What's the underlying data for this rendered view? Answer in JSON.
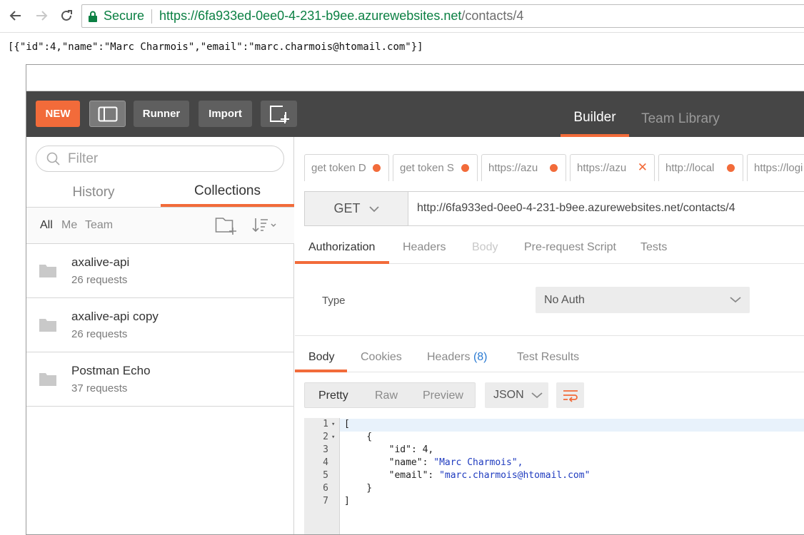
{
  "browser": {
    "secure_label": "Secure",
    "url_scheme": "https://",
    "url_host": "6fa933ed-0ee0-4-231-b9ee.azurewebsites.net",
    "url_path": "/contacts/4"
  },
  "raw_response": "[{\"id\":4,\"name\":\"Marc Charmois\",\"email\":\"marc.charmois@htomail.com\"}]",
  "header": {
    "new_label": "NEW",
    "runner_label": "Runner",
    "import_label": "Import",
    "builder_tab": "Builder",
    "team_library_tab": "Team Library"
  },
  "sidebar": {
    "filter_placeholder": "Filter",
    "tab_history": "History",
    "tab_collections": "Collections",
    "filter_all": "All",
    "filter_me": "Me",
    "filter_team": "Team",
    "collections": [
      {
        "name": "axalive-api",
        "count": "26 requests"
      },
      {
        "name": "axalive-api copy",
        "count": "26 requests"
      },
      {
        "name": "Postman Echo",
        "count": "37 requests"
      }
    ]
  },
  "request_tabs": [
    {
      "label": "get token D",
      "state": "unsaved"
    },
    {
      "label": "get token S",
      "state": "unsaved"
    },
    {
      "label": "https://azu",
      "state": "unsaved"
    },
    {
      "label": "https://azu",
      "state": "active-close"
    },
    {
      "label": "http://local",
      "state": "unsaved"
    },
    {
      "label": "https://logi",
      "state": "plain"
    }
  ],
  "request": {
    "method": "GET",
    "url": "http://6fa933ed-0ee0-4-231-b9ee.azurewebsites.net/contacts/4",
    "tabs": {
      "authorization": "Authorization",
      "headers": "Headers",
      "body": "Body",
      "pre_request": "Pre-request Script",
      "tests": "Tests"
    },
    "type_label": "Type",
    "auth_type": "No Auth"
  },
  "response": {
    "tabs": {
      "body": "Body",
      "cookies": "Cookies",
      "headers": "Headers",
      "headers_count": "(8)",
      "test_results": "Test Results"
    },
    "view": {
      "pretty": "Pretty",
      "raw": "Raw",
      "preview": "Preview"
    },
    "format": "JSON",
    "lines": [
      {
        "n": "1",
        "text": "["
      },
      {
        "n": "2",
        "text": "    {"
      },
      {
        "n": "3",
        "key": "\"id\"",
        "sep": ": ",
        "val": "4,",
        "plain": true
      },
      {
        "n": "4",
        "key": "\"name\"",
        "sep": ": ",
        "val": "\"Marc Charmois\",",
        "plain": false
      },
      {
        "n": "5",
        "key": "\"email\"",
        "sep": ": ",
        "val": "\"marc.charmois@htomail.com\"",
        "plain": false
      },
      {
        "n": "6",
        "text": "    }"
      },
      {
        "n": "7",
        "text": "]"
      }
    ]
  },
  "colors": {
    "accent": "#f26b3a",
    "header_bg": "#464646",
    "secure_green": "#0b8043",
    "json_string": "#1f3bbf"
  }
}
